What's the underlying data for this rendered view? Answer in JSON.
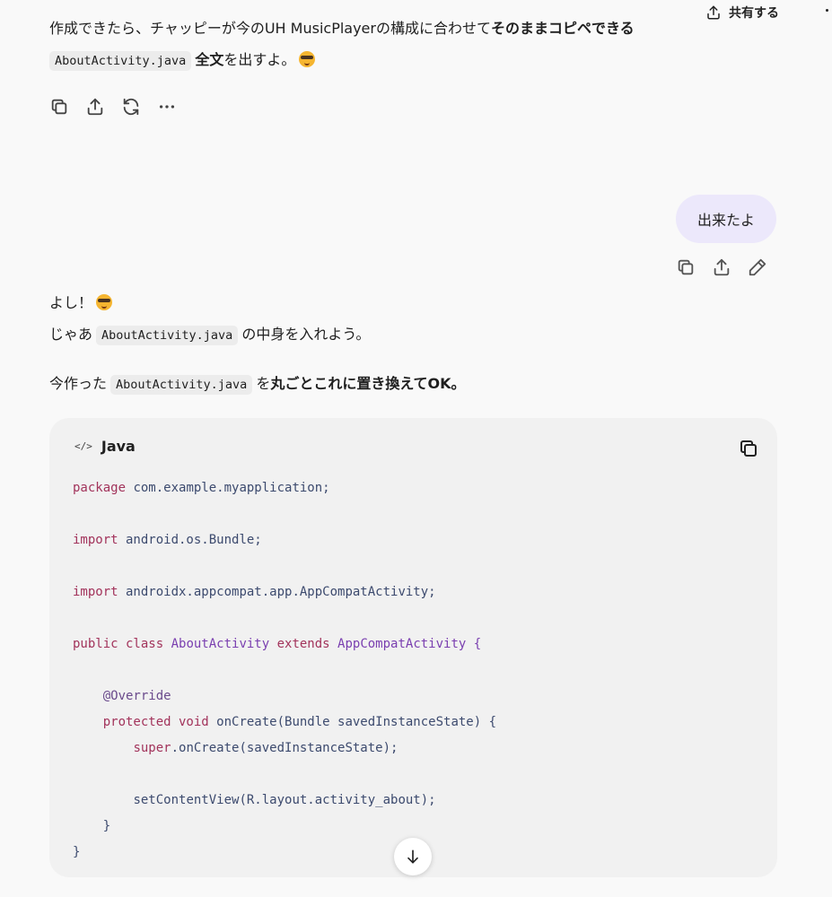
{
  "header": {
    "share_label": "共有する"
  },
  "assistant_message_1": {
    "line1_prefix": "作成できたら、チャッピーが今のUH MusicPlayerの構成に合わせて",
    "line1_bold": "そのままコピペできる",
    "line2_code": "AboutActivity.java",
    "line2_bold": "全文",
    "line2_suffix": "を出すよ。"
  },
  "user_message": {
    "text": "出来たよ"
  },
  "assistant_message_2": {
    "line1": "よし！",
    "line2_prefix": "じゃあ",
    "line2_code": "AboutActivity.java",
    "line2_suffix": "の中身を入れよう。",
    "line3_prefix": "今作った",
    "line3_code": "AboutActivity.java",
    "line3_suffix": "を",
    "line3_bold": "丸ごとこれに置き換えてOK。"
  },
  "code_block": {
    "language": "Java",
    "language_icon": "</>",
    "line1_kw": "package",
    "line1_rest": " com.example.myapplication;",
    "line2_kw": "import",
    "line2_rest": " android.os.Bundle;",
    "line3_kw": "import",
    "line3_rest": " androidx.appcompat.app.AppCompatActivity;",
    "line4_kw1": "public class",
    "line4_cls": " AboutActivity ",
    "line4_kw2": "extends",
    "line4_rest": " AppCompatActivity {",
    "line5_ann": "@Override",
    "line6_kw": "protected void",
    "line6_rest": " onCreate(Bundle savedInstanceState) {",
    "line7_kw": "super",
    "line7_rest": ".onCreate(savedInstanceState);",
    "line8": "setContentView(R.layout.activity_about);",
    "line9": "}",
    "line10": "}"
  },
  "icons": {
    "share": "share-icon",
    "copy": "copy-icon",
    "upload": "upload-icon",
    "regenerate": "regenerate-icon",
    "more": "more-icon",
    "edit": "edit-icon",
    "scroll_down": "arrow-down-icon"
  },
  "colors": {
    "user_bubble": "#ece8fb",
    "code_bg": "#f1f1f1",
    "keyword": "#a2335b",
    "class_name": "#7a3fb0"
  }
}
